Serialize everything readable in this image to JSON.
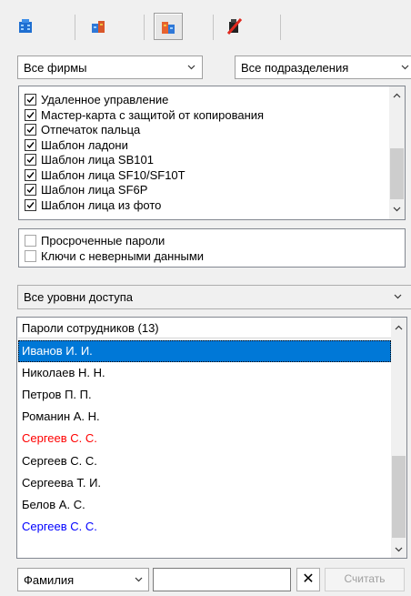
{
  "toolbar": {
    "buttons": [
      {
        "icon": "building-icon"
      },
      {
        "icon": "departments-icon"
      },
      {
        "icon": "people-icon"
      },
      {
        "icon": "no-pass-icon"
      }
    ]
  },
  "filters": {
    "company": "Все фирмы",
    "department": "Все подразделения"
  },
  "credential_types": [
    {
      "label": "Удаленное управление",
      "checked": true
    },
    {
      "label": "Мастер-карта с защитой от копирования",
      "checked": true
    },
    {
      "label": "Отпечаток пальца",
      "checked": true
    },
    {
      "label": "Шаблон ладони",
      "checked": true
    },
    {
      "label": "Шаблон лица SB101",
      "checked": true
    },
    {
      "label": "Шаблон лица SF10/SF10T",
      "checked": true
    },
    {
      "label": "Шаблон лица SF6P",
      "checked": true
    },
    {
      "label": "Шаблон лица из фото",
      "checked": true
    }
  ],
  "extra_filters": [
    {
      "label": "Просроченные пароли",
      "checked": false
    },
    {
      "label": "Ключи с неверными данными",
      "checked": false
    }
  ],
  "access_level": "Все уровни доступа",
  "employees": {
    "header": "Пароли сотрудников  (13)",
    "rows": [
      {
        "name": "Иванов И. И.",
        "color": "#ffffff",
        "selected": true
      },
      {
        "name": "Николаев Н. Н.",
        "color": "#000000",
        "selected": false
      },
      {
        "name": "Петров П. П.",
        "color": "#000000",
        "selected": false
      },
      {
        "name": "Романин А. Н.",
        "color": "#000000",
        "selected": false
      },
      {
        "name": "Сергеев С. С.",
        "color": "#ff0000",
        "selected": false
      },
      {
        "name": "Сергеев С. С.",
        "color": "#000000",
        "selected": false
      },
      {
        "name": "Сергеева Т. И.",
        "color": "#000000",
        "selected": false
      },
      {
        "name": "Белов А. С.",
        "color": "#000000",
        "selected": false
      },
      {
        "name": "Сергеев С. С.",
        "color": "#0000ff",
        "selected": false
      }
    ]
  },
  "search": {
    "field": "Фамилия",
    "value": "",
    "clear_label": "✕",
    "read_label": "Считать"
  },
  "colors": {
    "selection": "#0078d7",
    "expired": "#ff0000",
    "blue_entry": "#0000ff"
  }
}
